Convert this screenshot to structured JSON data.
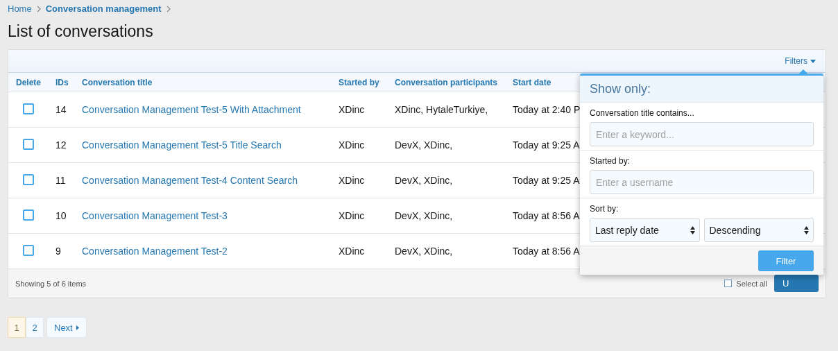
{
  "breadcrumb": [
    {
      "label": "Home"
    },
    {
      "label": "Conversation management"
    }
  ],
  "page_title": "List of conversations",
  "filters_button": "Filters",
  "table": {
    "columns": [
      "Delete",
      "IDs",
      "Conversation title",
      "Started by",
      "Conversation participants",
      "Start date"
    ],
    "rows": [
      {
        "checked": false,
        "id": "14",
        "title": "Conversation Management Test-5 With Attachment",
        "started_by": "XDinc",
        "participants": "XDinc, HytaleTurkiye,",
        "start_date": "Today at 2:40 P"
      },
      {
        "checked": false,
        "id": "12",
        "title": "Conversation Management Test-5 Title Search",
        "started_by": "XDinc",
        "participants": "DevX, XDinc,",
        "start_date": "Today at 9:25 A"
      },
      {
        "checked": false,
        "id": "11",
        "title": "Conversation Management Test-4 Content Search",
        "started_by": "XDinc",
        "participants": "DevX, XDinc,",
        "start_date": "Today at 9:25 A"
      },
      {
        "checked": false,
        "id": "10",
        "title": "Conversation Management Test-3",
        "started_by": "XDinc",
        "participants": "DevX, XDinc,",
        "start_date": "Today at 8:56 A"
      },
      {
        "checked": false,
        "id": "9",
        "title": "Conversation Management Test-2",
        "started_by": "XDinc",
        "participants": "DevX, XDinc,",
        "start_date": "Today at 8:56 A"
      }
    ]
  },
  "footer": {
    "summary": "Showing 5 of 6 items",
    "select_all": {
      "label": "Select all",
      "checked": false
    },
    "action_button": "U"
  },
  "pagination": {
    "pages": [
      {
        "label": "1",
        "selected": true
      },
      {
        "label": "2",
        "selected": false
      }
    ],
    "next": "Next"
  },
  "filter_menu": {
    "title": "Show only:",
    "title_filter": {
      "label": "Conversation title contains...",
      "placeholder": "Enter a keyword..."
    },
    "started_by_filter": {
      "label": "Started by:",
      "placeholder": "Enter a username"
    },
    "sort": {
      "label": "Sort by:",
      "field": "Last reply date",
      "order": "Descending"
    },
    "submit": "Filter"
  }
}
